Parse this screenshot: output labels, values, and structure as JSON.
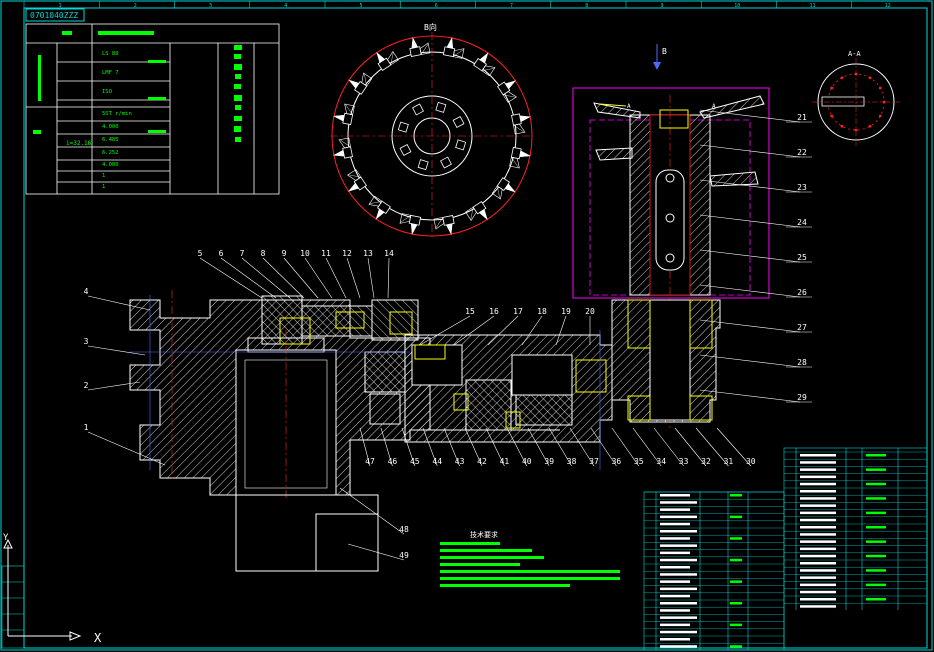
{
  "title_block": {
    "drawing_code": "0701040ZZZ",
    "zone_numbers": [
      "1",
      "2",
      "3",
      "4",
      "5",
      "6",
      "7",
      "8",
      "9",
      "10",
      "11",
      "12"
    ]
  },
  "callouts": {
    "left": [
      "4",
      "3",
      "2",
      "1"
    ],
    "top": [
      "5",
      "6",
      "7",
      "8",
      "9",
      "10",
      "11",
      "12",
      "13",
      "14"
    ],
    "middle_top": [
      "15",
      "16",
      "17",
      "18",
      "19",
      "20"
    ],
    "right": [
      "21",
      "22",
      "23",
      "24",
      "25",
      "26",
      "27",
      "28",
      "29"
    ],
    "bottom": [
      "47",
      "46",
      "45",
      "44",
      "43",
      "42",
      "41",
      "40",
      "39",
      "38",
      "37",
      "36",
      "35",
      "34",
      "33",
      "32",
      "31",
      "30"
    ],
    "base": [
      "48",
      "49"
    ]
  },
  "view_labels": {
    "section_top": "B向",
    "arrow_b": "B",
    "section_aa": "A-A",
    "cut_a_left": "A",
    "cut_a_right": "A"
  },
  "spec_table": {
    "rows": [
      "LS 80",
      "LMF 7",
      "ISO",
      "5ST r/min",
      "4.000",
      "6.485",
      "6.252",
      "4.000",
      "1",
      "1",
      "1"
    ],
    "ratio": "i=32.16"
  },
  "notes": {
    "heading": "技术要求"
  },
  "axis": {
    "y": "Y",
    "x": "X"
  },
  "colors": {
    "background": "#000000",
    "line": "#ffffff",
    "yellow": "#ffff00",
    "green": "#00ff00",
    "cyan": "#00d8d8",
    "red": "#ff2020",
    "magenta": "#ff00ff",
    "blue": "#4a6cff"
  }
}
